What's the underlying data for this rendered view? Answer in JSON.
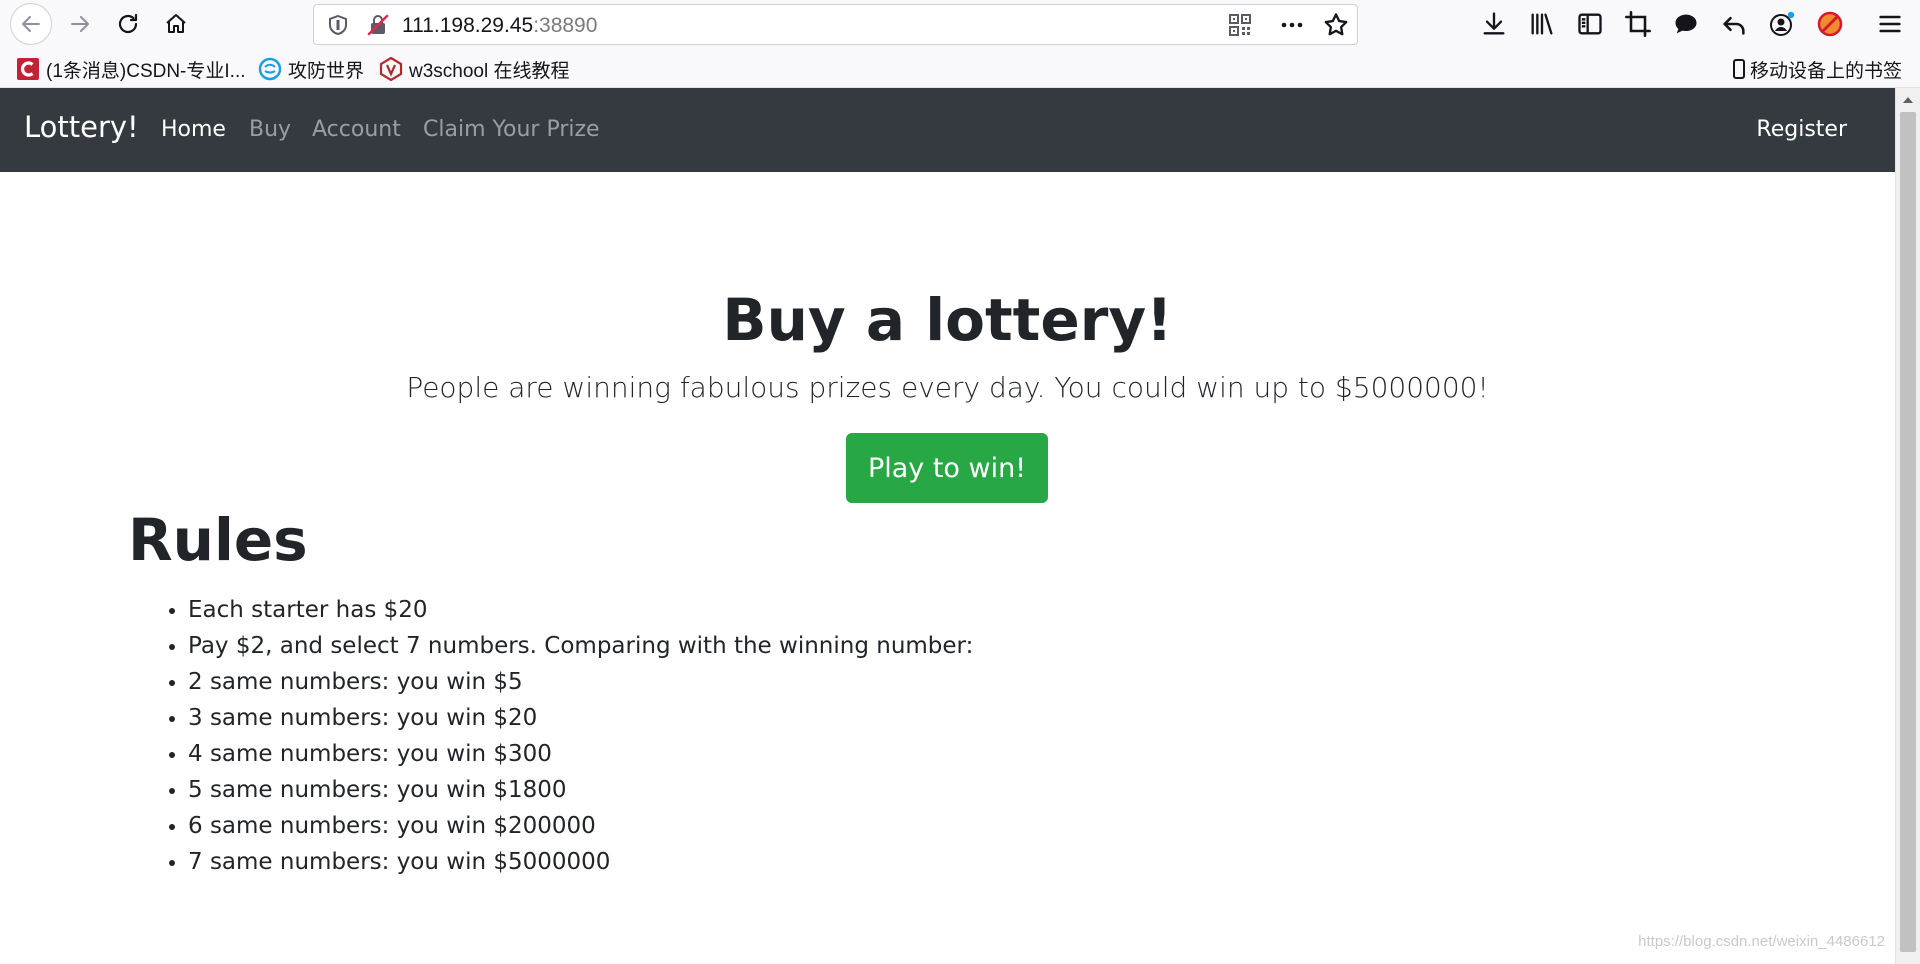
{
  "browser": {
    "url_host": "111.198.29.45",
    "url_port": ":38890",
    "bookmarks": [
      {
        "label": "(1条消息)CSDN-专业I...",
        "icon": "csdn-icon",
        "color": "#c32136"
      },
      {
        "label": "攻防世界",
        "icon": "adworld-icon",
        "color": "#1aa0e0"
      },
      {
        "label": "w3school 在线教程",
        "icon": "w3school-icon",
        "color": "#b3282d"
      }
    ],
    "mobile_bookmarks": "移动设备上的书签"
  },
  "navbar": {
    "brand": "Lottery!",
    "items": [
      {
        "label": "Home",
        "active": true
      },
      {
        "label": "Buy",
        "active": false
      },
      {
        "label": "Account",
        "active": false
      },
      {
        "label": "Claim Your Prize",
        "active": false
      }
    ],
    "register": "Register",
    "bg_color": "#343a40"
  },
  "jumbotron": {
    "title": "Buy a lottery!",
    "lead": "People are winning fabulous prizes every day. You could win up to $5000000!",
    "button": "Play to win!",
    "button_color": "#28a745"
  },
  "rules": {
    "title": "Rules",
    "items": [
      "Each starter has $20",
      "Pay $2, and select 7 numbers. Comparing with the winning number:",
      "2 same numbers: you win $5",
      "3 same numbers: you win $20",
      "4 same numbers: you win $300",
      "5 same numbers: you win $1800",
      "6 same numbers: you win $200000",
      "7 same numbers: you win $5000000"
    ]
  },
  "watermark": "https://blog.csdn.net/weixin_4486612"
}
